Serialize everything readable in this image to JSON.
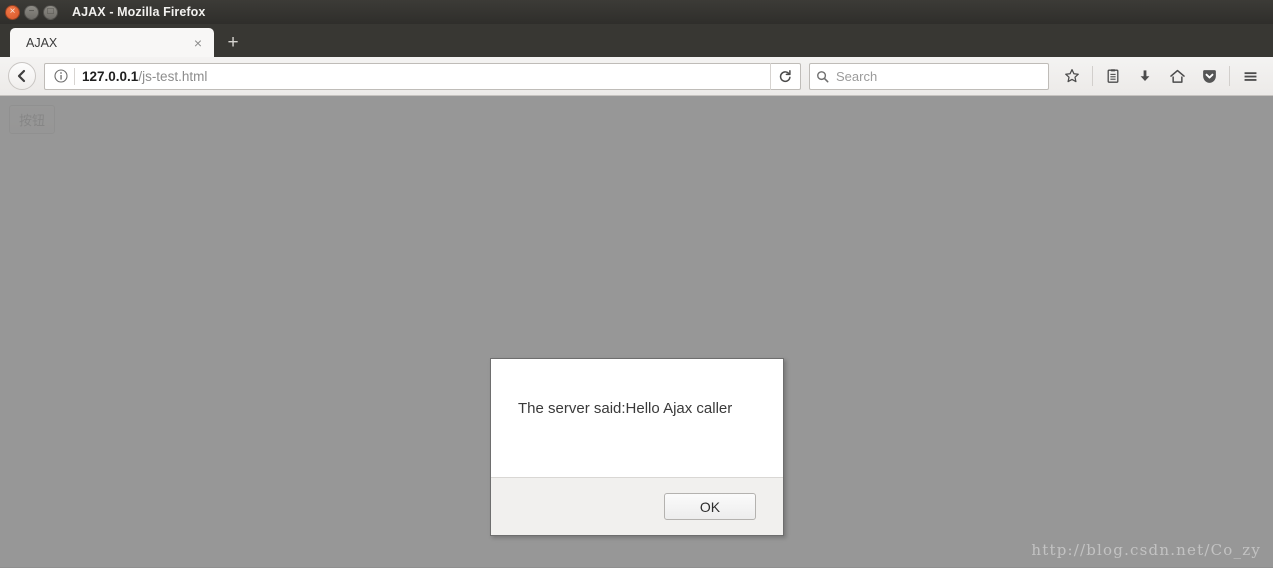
{
  "window": {
    "title": "AJAX - Mozilla Firefox",
    "controls": {
      "close": "×",
      "minimize": "−",
      "maximize": "□"
    }
  },
  "tabs": {
    "items": [
      {
        "label": "AJAX",
        "close": "×"
      }
    ],
    "new_tab": "+"
  },
  "toolbar": {
    "back": "←",
    "identity_icon": "ⓘ",
    "url_host": "127.0.0.1",
    "url_path": "/js-test.html",
    "reload": "↻",
    "search_placeholder": "Search",
    "search_icon": "⚲",
    "bookmark": "☆",
    "library": "Ὄb",
    "downloads": "⬇",
    "home": "⌂",
    "pocket": "⮟",
    "menu": "≡"
  },
  "page": {
    "button_label": "按钮",
    "watermark": "http://blog.csdn.net/Co_zy"
  },
  "dialog": {
    "message": "The server said:Hello Ajax caller",
    "ok_label": "OK"
  },
  "colors": {
    "titlebar": "#35342f",
    "accent_close": "#e2642c",
    "page_overlay": "#8f8f8f",
    "dialog_bg": "#ffffff"
  }
}
